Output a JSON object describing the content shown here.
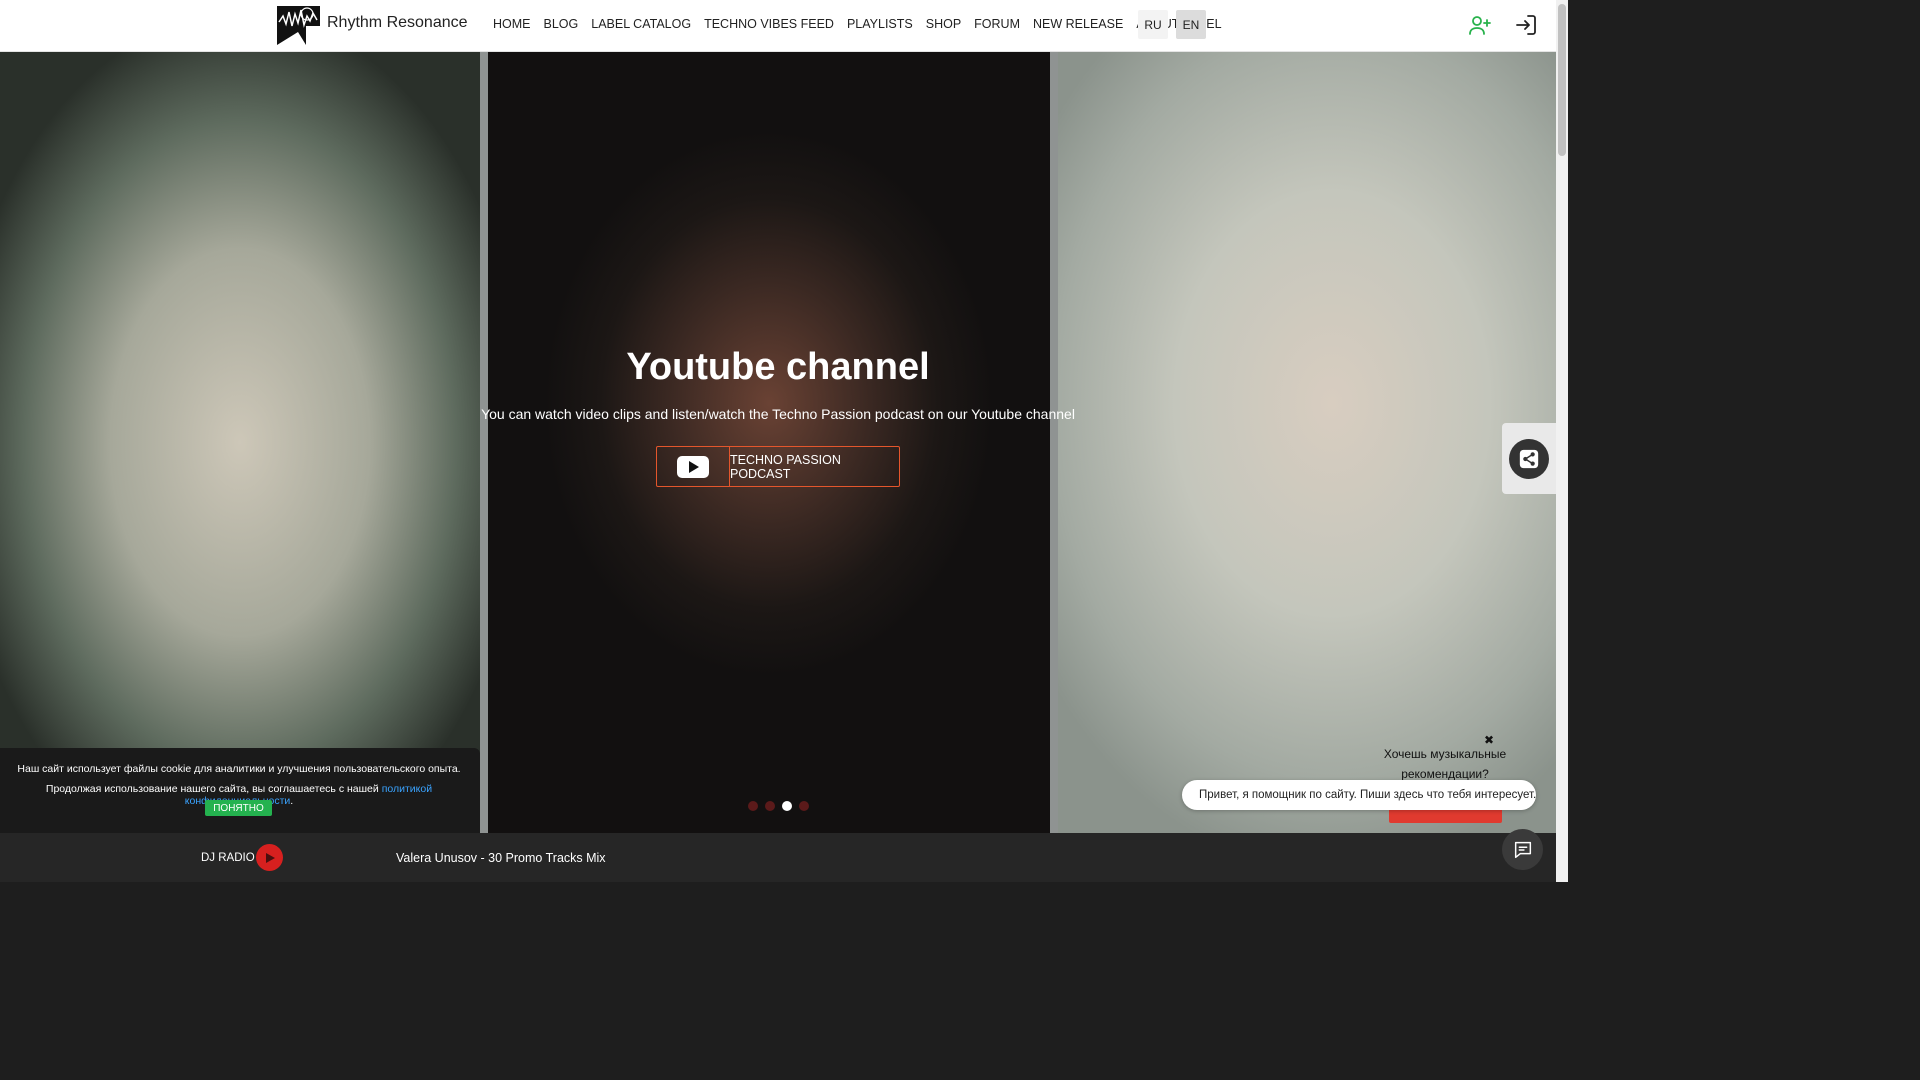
{
  "header": {
    "brand": "Rhythm Resonance",
    "nav": [
      "HOME",
      "BLOG",
      "LABEL CATALOG",
      "TECHNO VIBES FEED",
      "PLAYLISTS",
      "SHOP",
      "FORUM",
      "NEW RELEASE",
      "ABOUT LABEL"
    ],
    "languages": [
      "RU",
      "EN"
    ],
    "active_language": "EN",
    "icons": [
      "add-user-icon",
      "login-icon"
    ],
    "accent_color": "#27b24b"
  },
  "hero": {
    "title": "Youtube channel",
    "subtitle": "You can watch video clips and listen/watch the Techno Passion podcast on our Youtube channel",
    "button_label": "TECHNO PASSION PODCAST",
    "button_icon": "youtube-icon",
    "button_border_color": "#e4562c",
    "slides_count": 4,
    "active_slide": 3
  },
  "cookie": {
    "line1": "Наш сайт использует файлы cookie для аналитики и улучшения пользовательского опыта.",
    "line2_prefix": "Продолжая использование нашего сайта, вы соглашаетесь с нашей ",
    "link_text": "политикой конфиденциальности",
    "line2_suffix": ".",
    "accept_label": "ПОНЯТНО"
  },
  "assistant": {
    "close_symbol": "✖",
    "question": "Хочешь музыкальные рекомендации?",
    "bubble_text": "Привет, я помощник по сайту. Пиши здесь что тебя интересует...."
  },
  "player": {
    "radio_label": "DJ RADIO",
    "track": "Valera Unusov - 30 Promo Tracks Mix",
    "play_color": "#d7201f"
  }
}
